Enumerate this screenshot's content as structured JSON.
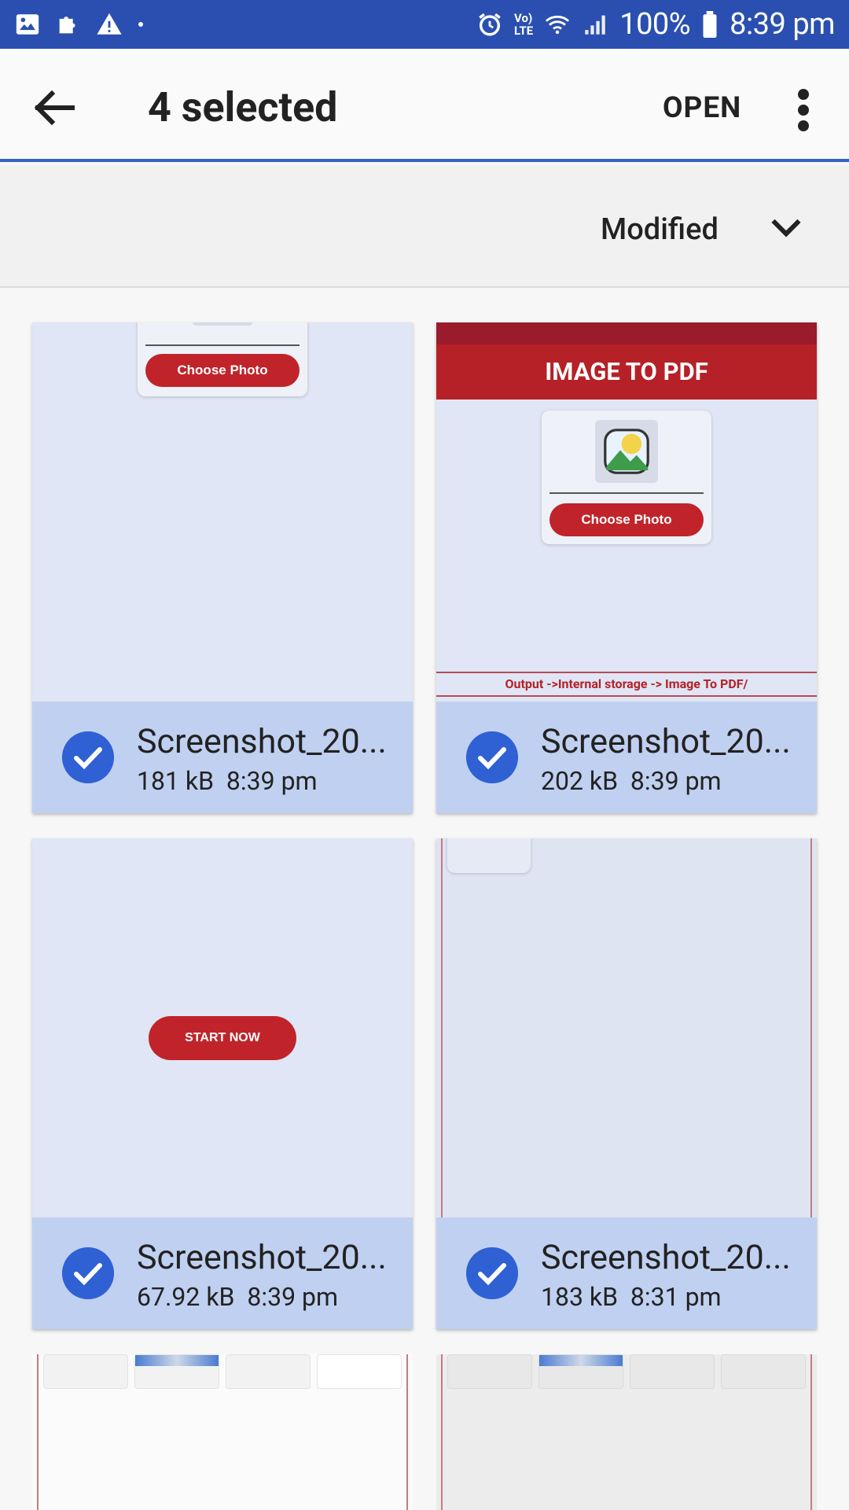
{
  "status_bar": {
    "battery": "100%",
    "time": "8:39 pm",
    "network_label_top": "Vo)",
    "network_label_bottom": "LTE"
  },
  "app_bar": {
    "title": "4 selected",
    "open_label": "OPEN"
  },
  "sort": {
    "label": "Modified"
  },
  "files": [
    {
      "name": "Screenshot_20...",
      "size": "181 kB",
      "time": "8:39 pm",
      "selected": true,
      "preview": {
        "button": "Choose Photo"
      }
    },
    {
      "name": "Screenshot_20...",
      "size": "202 kB",
      "time": "8:39 pm",
      "selected": true,
      "preview": {
        "header": "IMAGE TO PDF",
        "button": "Choose Photo",
        "output": "Output ->Internal storage -> Image To PDF/"
      }
    },
    {
      "name": "Screenshot_20...",
      "size": "67.92 kB",
      "time": "8:39 pm",
      "selected": true,
      "preview": {
        "button": "START NOW"
      }
    },
    {
      "name": "Screenshot_20...",
      "size": "183 kB",
      "time": "8:31 pm",
      "selected": true,
      "preview": {}
    }
  ],
  "colors": {
    "status_bar": "#2a4fb0",
    "accent": "#2f61d4",
    "selected_footer": "#c0d0f0",
    "preview_red": "#c0242a"
  }
}
